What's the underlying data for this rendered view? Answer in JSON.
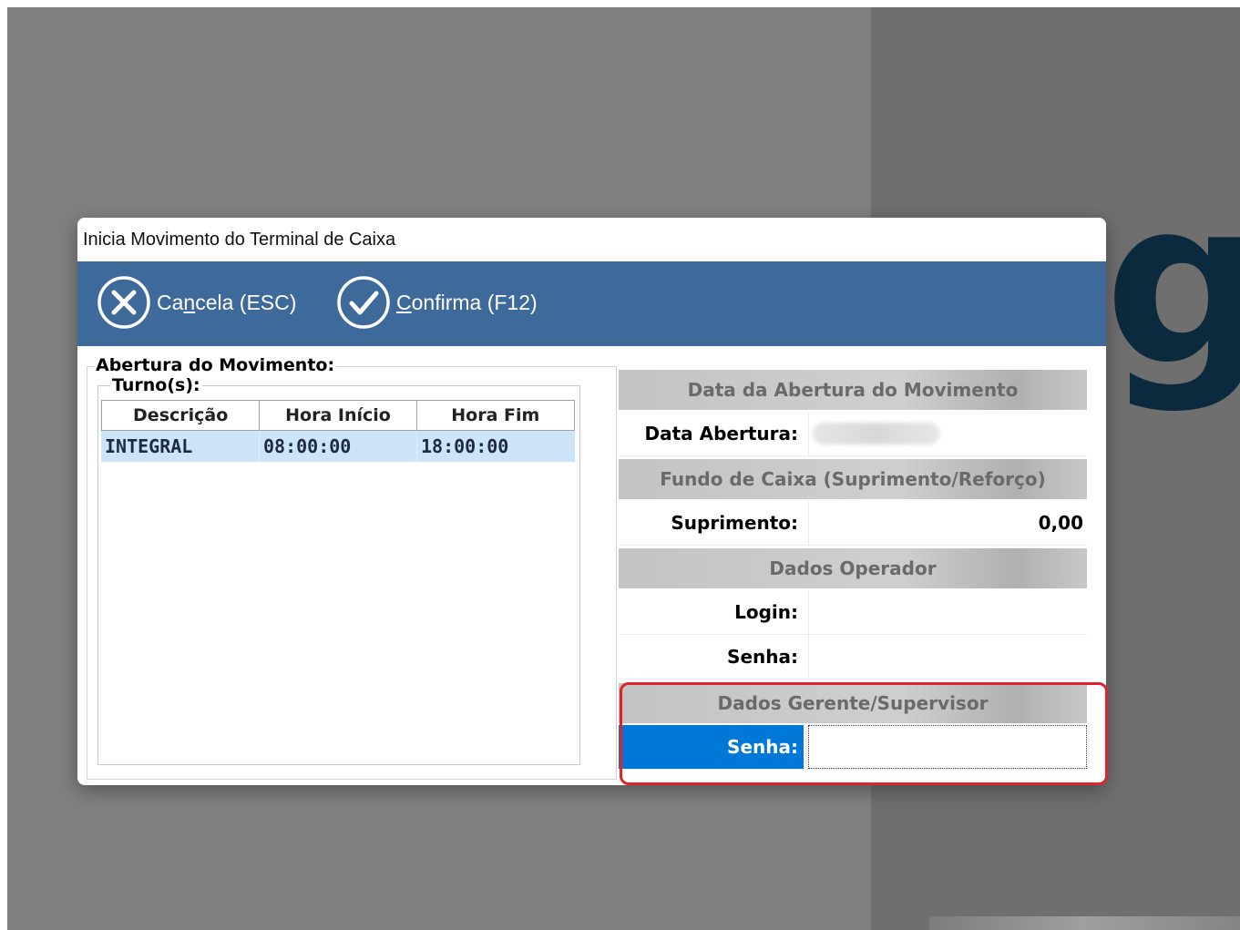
{
  "window": {
    "title": "Inicia Movimento do Terminal de Caixa"
  },
  "toolbar": {
    "cancel_prefix": "Ca",
    "cancel_mnemonic": "n",
    "cancel_suffix": "cela (ESC)",
    "confirm_mnemonic": "C",
    "confirm_suffix": "onfirma (F12)"
  },
  "movement": {
    "legend": "Abertura do Movimento:",
    "shifts": {
      "legend": "Turno(s):",
      "columns": [
        "Descrição",
        "Hora Início",
        "Hora Fim"
      ],
      "rows": [
        [
          "INTEGRAL",
          "08:00:00",
          "18:00:00"
        ]
      ]
    }
  },
  "panel": {
    "opening_date": {
      "header": "Data da Abertura do Movimento",
      "label": "Data Abertura:"
    },
    "cash_fund": {
      "header": "Fundo de Caixa (Suprimento/Reforço)",
      "label": "Suprimento:",
      "value": "0,00"
    },
    "operator": {
      "header": "Dados Operador",
      "login_label": "Login:",
      "login_value": "",
      "password_label": "Senha:",
      "password_value": ""
    },
    "manager": {
      "header": "Dados Gerente/Supervisor",
      "password_label": "Senha:",
      "password_value": ""
    }
  },
  "colors": {
    "toolbar_bg": "#3d6a9b",
    "selection_row": "#cce4f7",
    "active_label": "#0078d7",
    "highlight_border": "#e0232a"
  },
  "icons": {
    "cancel": "cancel-circle-icon",
    "confirm": "check-circle-icon"
  }
}
